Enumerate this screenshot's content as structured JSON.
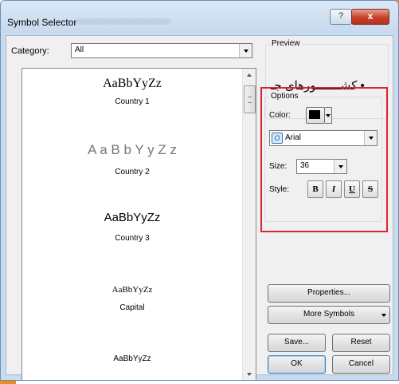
{
  "window": {
    "title": "Symbol Selector",
    "help_glyph": "?",
    "close_glyph": "x"
  },
  "category": {
    "label": "Category:",
    "value": "All"
  },
  "symbols": [
    {
      "sample": "AaBbYyZz",
      "caption": "Country 1"
    },
    {
      "sample": "A a B b Y y Z z",
      "caption": "Country 2"
    },
    {
      "sample": "AaBbYyZz",
      "caption": "Country 3"
    },
    {
      "sample": "AaBbYyZz",
      "caption": "Capital"
    },
    {
      "sample": "AaBbYyZz",
      "caption": ""
    }
  ],
  "preview": {
    "title": "Preview",
    "text": "• کشـــــــورهای جـ"
  },
  "options": {
    "title": "Options",
    "color_label": "Color:",
    "color_value": "#000000",
    "font_value": "Arial",
    "font_icon": "O",
    "size_label": "Size:",
    "size_value": "36",
    "style_label": "Style:",
    "style_buttons": [
      "B",
      "I",
      "U",
      "S"
    ]
  },
  "buttons": {
    "properties": "Properties...",
    "more_symbols": "More Symbols",
    "save": "Save...",
    "reset": "Reset",
    "ok": "OK",
    "cancel": "Cancel"
  },
  "colors": {
    "highlight_border": "#e0232f",
    "title_bar": "#c9dbef",
    "close_button": "#c5412b",
    "background_accent": "#f28a16"
  }
}
